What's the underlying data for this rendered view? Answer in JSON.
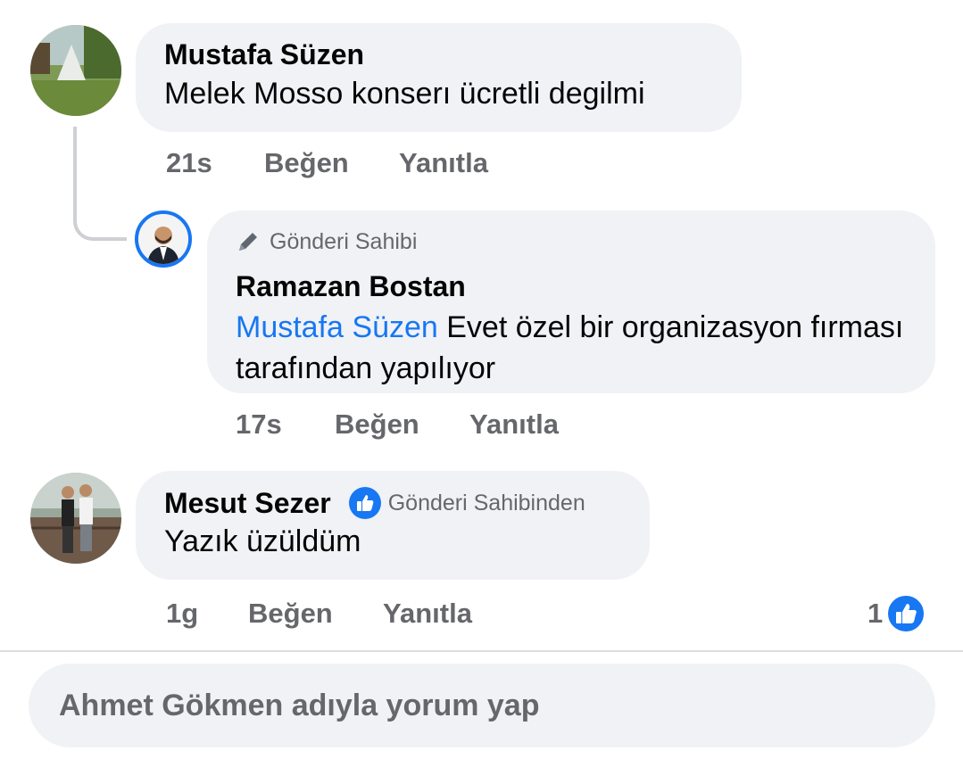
{
  "comments": [
    {
      "author": "Mustafa Süzen",
      "text": "Melek Mosso konserı ücretli degilmi",
      "time": "21s",
      "like_label": "Beğen",
      "reply_label": "Yanıtla"
    },
    {
      "badge": "Gönderi Sahibi",
      "author": "Ramazan Bostan",
      "mention": "Mustafa Süzen",
      "text": "Evet özel bir organizasyon fırması tarafından yapılıyor",
      "time": "17s",
      "like_label": "Beğen",
      "reply_label": "Yanıtla"
    },
    {
      "author": "Mesut Sezer",
      "badge": "Gönderi Sahibinden",
      "text": "Yazık üzüldüm",
      "time": "1g",
      "like_label": "Beğen",
      "reply_label": "Yanıtla",
      "reaction_count": "1"
    }
  ],
  "composer": {
    "placeholder": "Ahmet Gökmen adıyla yorum yap"
  },
  "colors": {
    "accent": "#1877f2",
    "bubble": "#f0f2f5",
    "secondary_text": "#65676b"
  },
  "icons": {
    "owner_badge": "pencil-icon",
    "like_badge": "thumbs-up-icon",
    "reaction": "thumbs-up-reaction-icon"
  }
}
